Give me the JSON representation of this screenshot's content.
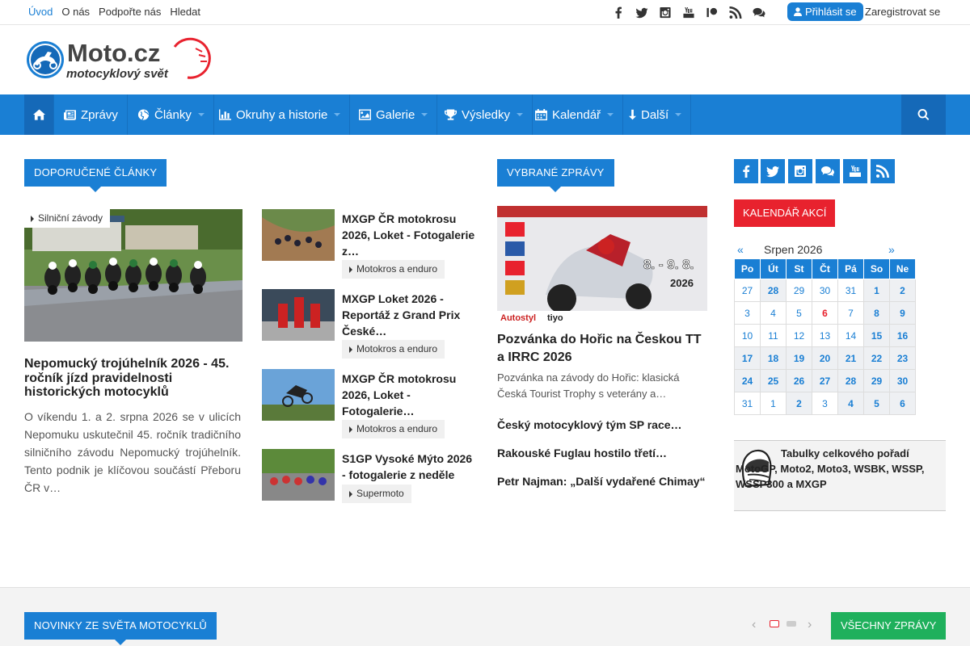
{
  "topbar": {
    "links": [
      "Úvod",
      "O nás",
      "Podpořte nás",
      "Hledat"
    ],
    "social_icons": [
      "facebook-icon",
      "twitter-icon",
      "instagram-icon",
      "youtube-icon",
      "patreon-icon",
      "rss-icon",
      "chat-icon"
    ],
    "login_label": "Přihlásit se",
    "register_label": "Zaregistrovat se"
  },
  "logo": {
    "brand": "Moto.cz",
    "tagline": "motocyklový svět"
  },
  "nav": {
    "items": [
      {
        "label": "Zprávy",
        "icon": "newspaper-icon",
        "caret": false
      },
      {
        "label": "Články",
        "icon": "globe-icon",
        "caret": true
      },
      {
        "label": "Okruhy a historie",
        "icon": "bar-chart-icon",
        "caret": true
      },
      {
        "label": "Galerie",
        "icon": "image-icon",
        "caret": true
      },
      {
        "label": "Výsledky",
        "icon": "trophy-icon",
        "caret": true
      },
      {
        "label": "Kalendář",
        "icon": "calendar-icon",
        "caret": true
      },
      {
        "label": "Další",
        "icon": "sort-down-icon",
        "caret": true
      }
    ]
  },
  "recommended": {
    "heading": "DOPORUČENÉ ČLÁNKY",
    "main": {
      "tag": "Silniční závody",
      "title": "Nepomucký trojúhelník 2026 - 45. ročník jízd pravidelnosti historických motocyklů",
      "excerpt": "O víkendu 1. a 2. srpna 2026 se v ulicích Nepomuku uskutečnil 45. ročník tradičního silničního závodu Nepomucký trojúhelník. Tento podnik je klíčovou součástí Přeboru ČR v…"
    },
    "list": [
      {
        "title": "MXGP ČR motokrosu 2026, Loket - Fotogalerie z…",
        "tag": "Motokros a enduro"
      },
      {
        "title": "MXGP Loket 2026 - Reportáž z Grand Prix České…",
        "tag": "Motokros a enduro"
      },
      {
        "title": "MXGP ČR motokrosu 2026, Loket - Fotogalerie…",
        "tag": "Motokros a enduro"
      },
      {
        "title": "S1GP Vysoké Mýto 2026 - fotogalerie z neděle",
        "tag": "Supermoto"
      }
    ]
  },
  "selected": {
    "heading": "VYBRANÉ ZPRÁVY",
    "poster": {
      "dates": "8. - 9. 8.",
      "year": "2026",
      "sponsors": [
        "Autostyl",
        "tiyo"
      ]
    },
    "main_title": "Pozvánka do Hořic na Českou TT a IRRC 2026",
    "main_excerpt": "Pozvánka na závody do Hořic: klasická Česká Tourist Trophy s veterány a…",
    "links": [
      "Český motocyklový tým SP race…",
      "Rakouské Fuglau hostilo třetí…",
      "Petr Najman: „Další vydařené Chimay“"
    ]
  },
  "sidebar": {
    "social_icons": [
      "facebook-icon",
      "twitter-icon",
      "instagram-icon",
      "chat-icon",
      "youtube-icon",
      "rss-icon"
    ],
    "calendar": {
      "heading": "KALENDÁŘ AKCÍ",
      "prev": "«",
      "next": "»",
      "month": "Srpen 2026",
      "weekdays": [
        "Po",
        "Út",
        "St",
        "Čt",
        "Pá",
        "So",
        "Ne"
      ],
      "weeks": [
        [
          "27",
          "28",
          "29",
          "30",
          "31",
          "1",
          "2"
        ],
        [
          "3",
          "4",
          "5",
          "6",
          "7",
          "8",
          "9"
        ],
        [
          "10",
          "11",
          "12",
          "13",
          "14",
          "15",
          "16"
        ],
        [
          "17",
          "18",
          "19",
          "20",
          "21",
          "22",
          "23"
        ],
        [
          "24",
          "25",
          "26",
          "27",
          "28",
          "29",
          "30"
        ],
        [
          "31",
          "1",
          "2",
          "3",
          "4",
          "5",
          "6"
        ]
      ],
      "event_days": [
        "0-1",
        "0-5",
        "0-6",
        "1-5",
        "1-6",
        "2-5",
        "2-6",
        "3-0",
        "3-1",
        "3-2",
        "3-3",
        "3-4",
        "3-5",
        "3-6",
        "4-0",
        "4-1",
        "4-2",
        "4-3",
        "4-4",
        "4-5",
        "4-6",
        "5-2",
        "5-4",
        "5-5",
        "5-6"
      ],
      "today": "1-3"
    },
    "results_text": "Tabulky celkového pořadí MotoGP, Moto2, Moto3, WSBK, WSSP, WSSP300 a MXGP"
  },
  "bottom": {
    "heading": "NOVINKY ZE SVĚTA MOTOCYKLŮ",
    "all_news": "VŠECHNY ZPRÁVY",
    "prev": "‹",
    "next": "›"
  },
  "colors": {
    "accent": "#1a7fd4",
    "red": "#e8222e",
    "green": "#1fb05c"
  }
}
